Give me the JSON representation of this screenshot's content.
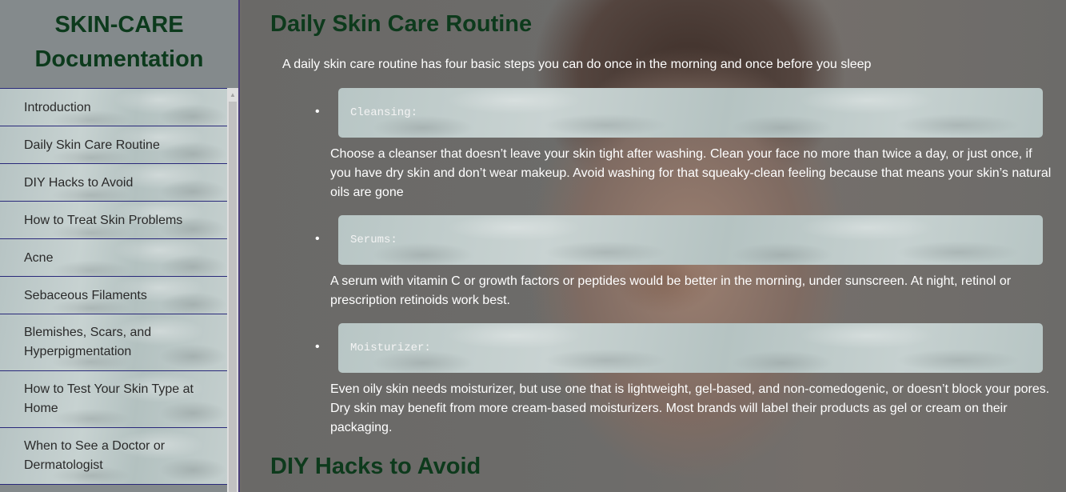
{
  "sidebar": {
    "title_line1": "SKIN-CARE",
    "title_line2": "Documentation",
    "items": [
      {
        "label": "Introduction"
      },
      {
        "label": "Daily Skin Care Routine"
      },
      {
        "label": "DIY Hacks to Avoid"
      },
      {
        "label": "How to Treat Skin Problems"
      },
      {
        "label": "Acne"
      },
      {
        "label": "Sebaceous Filaments"
      },
      {
        "label": "Blemishes, Scars, and Hyperpigmentation"
      },
      {
        "label": "How to Test Your Skin Type at Home"
      },
      {
        "label": "When to See a Doctor or Dermatologist"
      }
    ]
  },
  "main": {
    "heading": "Daily Skin Care Routine",
    "intro": "A daily skin care routine has four basic steps you can do once in the morning and once before you sleep",
    "steps": [
      {
        "code": "Cleansing:",
        "description": "Choose a cleanser that doesn’t leave your skin tight after washing. Clean your face no more than twice a day, or just once, if you have dry skin and don’t wear makeup. Avoid washing for that squeaky-clean feeling because that means your skin’s natural oils are gone"
      },
      {
        "code": "Serums:",
        "description": "A serum with vitamin C or growth factors or peptides would be better in the morning, under sunscreen. At night, retinol or prescription retinoids work best."
      },
      {
        "code": "Moisturizer:",
        "description": "Even oily skin needs moisturizer, but use one that is lightweight, gel-based, and non-comedogenic, or doesn’t block your pores. Dry skin may benefit from more cream-based moisturizers. Most brands will label their products as gel or cream on their packaging."
      }
    ],
    "next_heading": "DIY Hacks to Avoid"
  },
  "icons": {
    "bullet": "•",
    "scroll_up": "▲"
  }
}
